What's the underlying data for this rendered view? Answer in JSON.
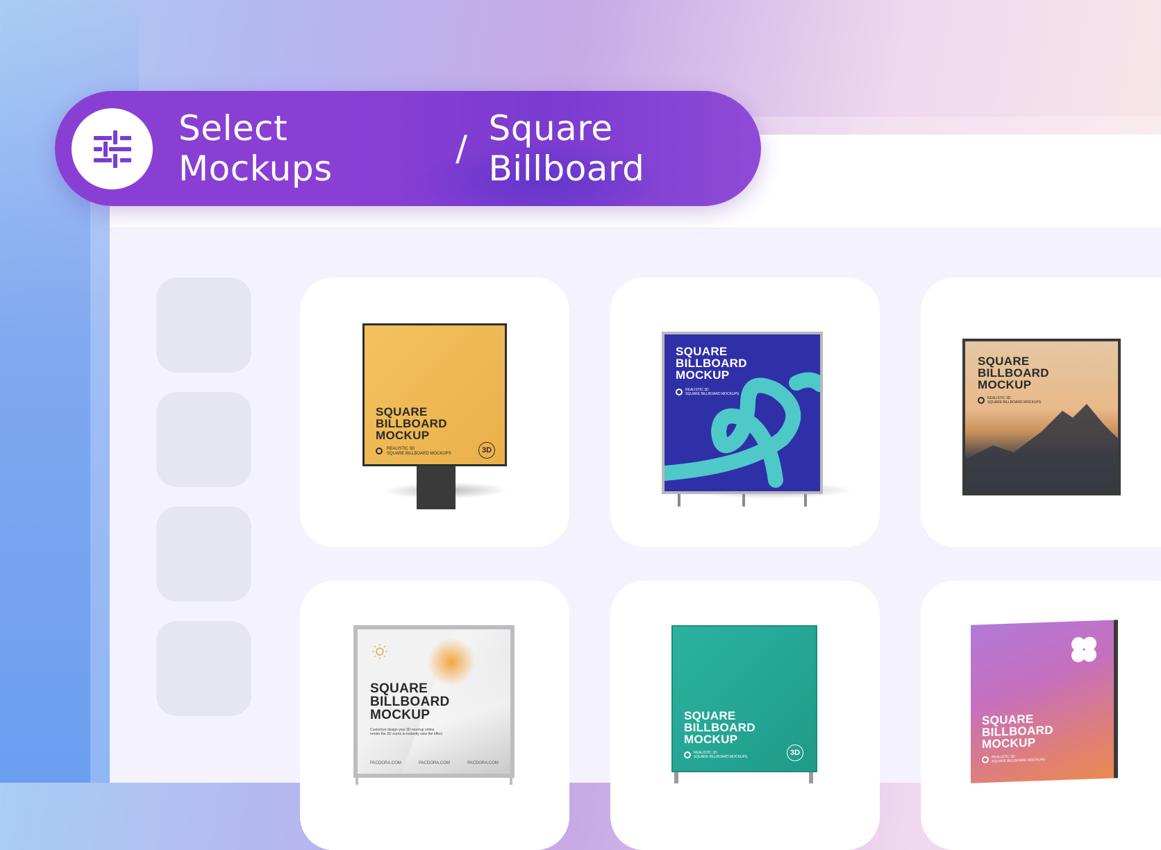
{
  "header": {
    "icon": "sliders-icon",
    "breadcrumb_parent": "Select Mockups",
    "separator": "/",
    "breadcrumb_current": "Square Billboard"
  },
  "colors": {
    "accent_purple": "#8a3fd4",
    "sidebar_tile": "#e6e5f2",
    "content_bg": "#f4f3fd"
  },
  "mockups": [
    {
      "title": "SQUARE\nBILLBOARD\nMOCKUP",
      "subtitle": "REALISTIC 3D\nSQUARE BILLBOARD MOCKUPS",
      "badge": "3D",
      "color": "#f0b94e"
    },
    {
      "title": "SQUARE\nBILLBOARD\nMOCKUP",
      "subtitle": "REALISTIC 3D\nSQUARE BILLBOARD MOCKUPS",
      "color": "#2f2fa8"
    },
    {
      "title": "SQUARE\nBILLBOARD\nMOCKUP",
      "subtitle": "REALISTIC 3D\nSQUARE BILLBOARD MOCKUPS",
      "color": "#d9b48e"
    },
    {
      "title": "SQUARE\nBILLBOARD\nMOCKUP",
      "subtitle": "Customize design your 3D mockup online,\nrender the 3D scene to instantly view the effect",
      "footer": [
        "PACDORA.COM",
        "PACDORA.COM",
        "PACDORA.COM"
      ],
      "color": "#e9e9ea"
    },
    {
      "title": "SQUARE\nBILLBOARD\nMOCKUP",
      "subtitle": "REALISTIC 3D\nSQUARE BILLBOARD MOCKUPS",
      "badge": "3D",
      "color": "#24a896"
    },
    {
      "title": "SQUARE\nBILLBOARD\nMOCKUP",
      "subtitle": "REALISTIC 3D\nSQUARE BILLBOARD MOCKUPS",
      "color": "#c26fc8"
    }
  ]
}
